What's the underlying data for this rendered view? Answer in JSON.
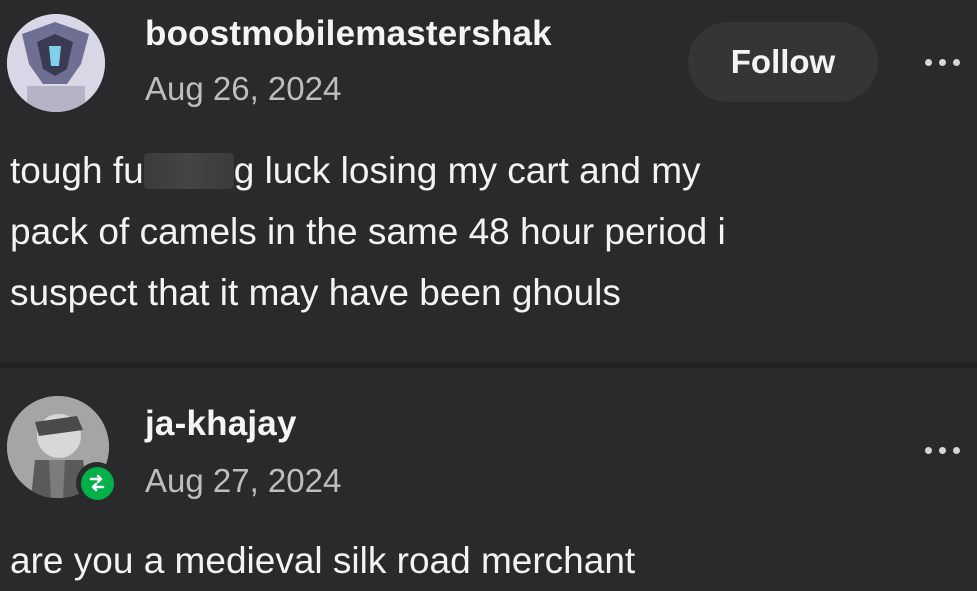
{
  "posts": [
    {
      "username": "boostmobilemastershak",
      "date": "Aug 26, 2024",
      "follow_label": "Follow",
      "body_lines": [
        "tough fu",
        "g luck losing my cart and my",
        "pack of camels in the same 48 hour period i",
        "suspect that it may have been ghouls"
      ],
      "icons": {
        "avatar": "avatar-icon",
        "more": "more-options-icon"
      }
    },
    {
      "username": "ja-khajay",
      "date": "Aug 27, 2024",
      "body": "are you a medieval silk road merchant",
      "icons": {
        "avatar": "avatar-icon",
        "reblog": "reblog-icon",
        "more": "more-options-icon"
      }
    }
  ],
  "colors": {
    "background": "#2a2a2c",
    "button_bg": "#353537",
    "text": "#f2f2f2",
    "secondary_text": "#bdbdbd",
    "reblog_green": "#00b14a"
  }
}
